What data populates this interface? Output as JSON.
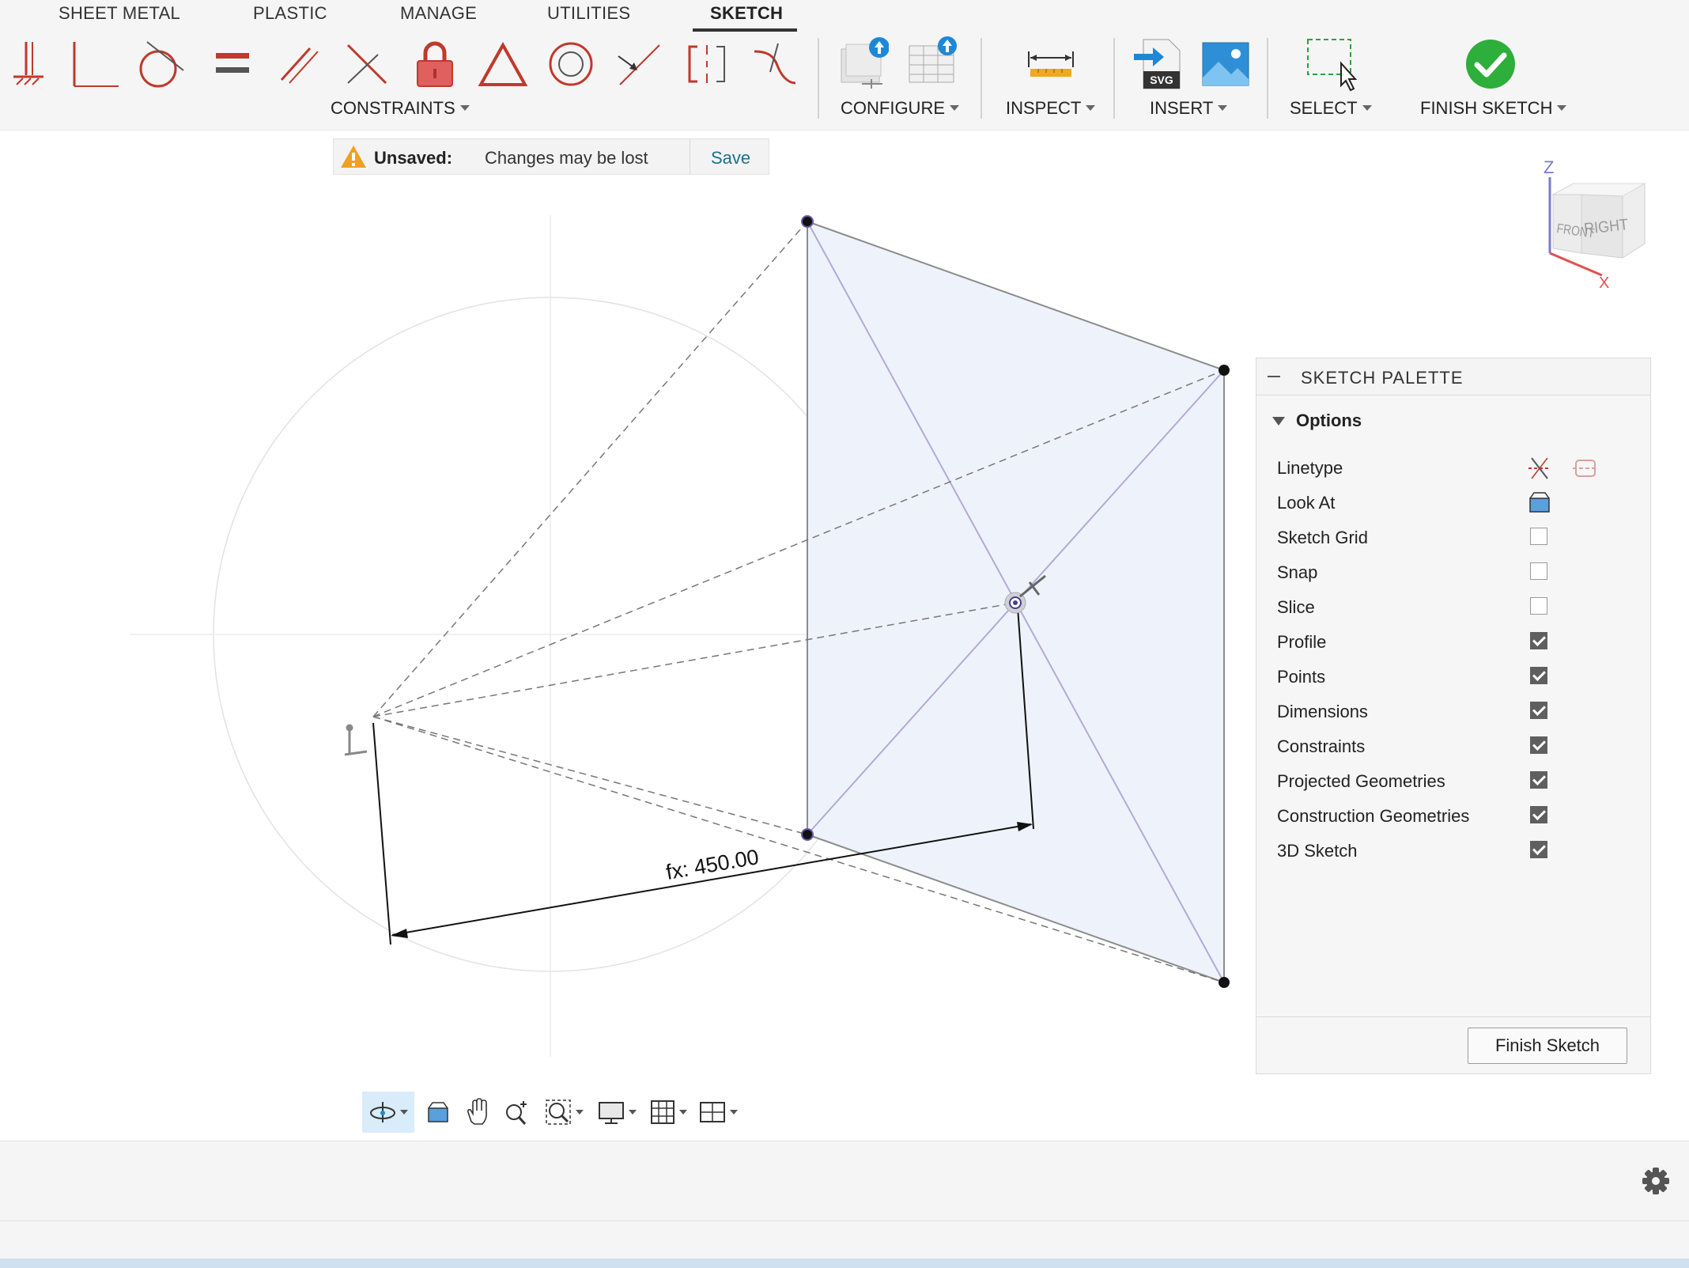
{
  "ribbon": {
    "tabs": [
      "SHEET METAL",
      "PLASTIC",
      "MANAGE",
      "UTILITIES",
      "SKETCH"
    ],
    "active_tab": "SKETCH",
    "groups": {
      "constraints": "CONSTRAINTS",
      "configure": "CONFIGURE",
      "inspect": "INSPECT",
      "insert": "INSERT",
      "select": "SELECT",
      "finish": "FINISH SKETCH"
    },
    "insert_svg_badge": "SVG"
  },
  "banner": {
    "label": "Unsaved:",
    "message": "Changes may be lost",
    "save": "Save"
  },
  "viewcube": {
    "front": "FRONT",
    "right": "RIGHT",
    "z": "Z",
    "x": "X"
  },
  "canvas": {
    "dimension": "fx: 450.00"
  },
  "palette": {
    "title": "SKETCH PALETTE",
    "options": "Options",
    "rows": [
      {
        "label": "Linetype",
        "control": "icons"
      },
      {
        "label": "Look At",
        "control": "icon"
      },
      {
        "label": "Sketch Grid",
        "checked": false
      },
      {
        "label": "Snap",
        "checked": false
      },
      {
        "label": "Slice",
        "checked": false
      },
      {
        "label": "Profile",
        "checked": true
      },
      {
        "label": "Points",
        "checked": true
      },
      {
        "label": "Dimensions",
        "checked": true
      },
      {
        "label": "Constraints",
        "checked": true
      },
      {
        "label": "Projected Geometries",
        "checked": true
      },
      {
        "label": "Construction Geometries",
        "checked": true
      },
      {
        "label": "3D Sketch",
        "checked": true
      }
    ],
    "finish_button": "Finish Sketch"
  },
  "navbar": {
    "icons": [
      "orbit-icon",
      "look-at-icon",
      "pan-icon",
      "zoom-icon",
      "fit-icon",
      "display-settings-icon",
      "grid-icon",
      "viewports-icon"
    ]
  },
  "colors": {
    "accent_red": "#c0392b",
    "save_link": "#1d6f92",
    "finish_green": "#2eae3a",
    "profile_fill": "#eef3fb"
  }
}
